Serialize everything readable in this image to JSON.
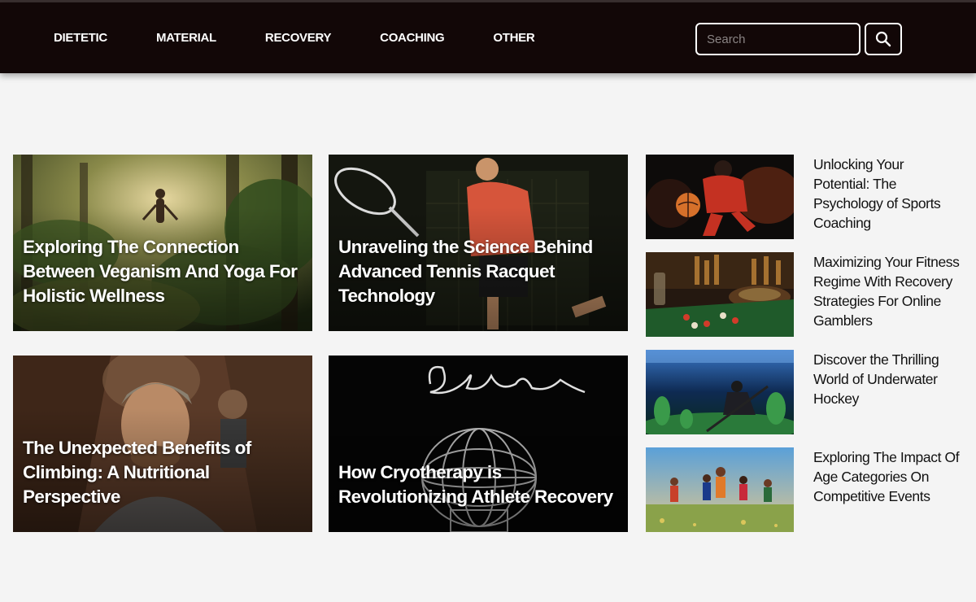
{
  "nav": {
    "links": [
      "DIETETIC",
      "MATERIAL",
      "RECOVERY",
      "COACHING",
      "OTHER"
    ]
  },
  "search": {
    "placeholder": "Search",
    "button_icon": "search-icon"
  },
  "featured": [
    {
      "title": "Exploring The Connection Between Veganism And Yoga For Holistic Wellness",
      "image": "yoga-jungle-image"
    },
    {
      "title": "Unraveling the Science Behind Advanced Tennis Racquet Technology",
      "image": "tennis-player-image"
    },
    {
      "title": "The Unexpected Benefits of Climbing: A Nutritional Perspective",
      "image": "climber-image"
    },
    {
      "title": "How Cryotherapy is Revolutionizing Athlete Recovery",
      "image": "cryo-wireframe-image"
    }
  ],
  "sidebar": [
    {
      "title": "Unlocking Your Potential: The Psychology of Sports Coaching",
      "image": "basketball-player-image"
    },
    {
      "title": "Maximizing Your Fitness Regime With Recovery Strategies For Online Gamblers",
      "image": "casino-table-image"
    },
    {
      "title": "Discover the Thrilling World of Underwater Hockey",
      "image": "underwater-hockey-image"
    },
    {
      "title": "Exploring The Impact Of Age Categories On Competitive Events",
      "image": "runners-race-image"
    }
  ],
  "colors": {
    "navbar_bg": "#120707",
    "page_bg": "#f4f4f4",
    "nav_text": "#ffffff",
    "side_text": "#111111"
  }
}
